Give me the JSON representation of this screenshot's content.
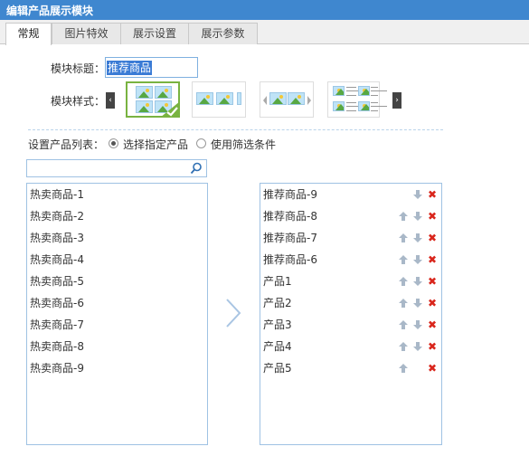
{
  "window": {
    "title": "编辑产品展示模块"
  },
  "tabs": [
    {
      "label": "常规",
      "active": true
    },
    {
      "label": "图片特效",
      "active": false
    },
    {
      "label": "展示设置",
      "active": false
    },
    {
      "label": "展示参数",
      "active": false
    }
  ],
  "module_title": {
    "label": "模块标题：",
    "value": "推荐商品"
  },
  "module_style": {
    "label": "模块样式：",
    "selected_index": 0
  },
  "product_list": {
    "label": "设置产品列表：",
    "options": [
      "选择指定产品",
      "使用筛选条件"
    ],
    "selected": "选择指定产品"
  },
  "search": {
    "value": "",
    "placeholder": ""
  },
  "source_items": [
    "热卖商品-1",
    "热卖商品-2",
    "热卖商品-3",
    "热卖商品-4",
    "热卖商品-5",
    "热卖商品-6",
    "热卖商品-7",
    "热卖商品-8",
    "热卖商品-9"
  ],
  "selected_items": [
    {
      "label": "推荐商品-9",
      "up": false,
      "down": true
    },
    {
      "label": "推荐商品-8",
      "up": true,
      "down": true
    },
    {
      "label": "推荐商品-7",
      "up": true,
      "down": true
    },
    {
      "label": "推荐商品-6",
      "up": true,
      "down": true
    },
    {
      "label": "产品1",
      "up": true,
      "down": true
    },
    {
      "label": "产品2",
      "up": true,
      "down": true
    },
    {
      "label": "产品3",
      "up": true,
      "down": true
    },
    {
      "label": "产品4",
      "up": true,
      "down": true
    },
    {
      "label": "产品5",
      "up": true,
      "down": false
    }
  ],
  "colors": {
    "titlebar": "#3f87cf",
    "accent_green": "#79b341",
    "remove_red": "#d9261c",
    "arrow_gray": "#a9b8c8"
  },
  "icons": {
    "move_right": "chevron-right-icon",
    "search": "search-icon",
    "up": "arrow-up-icon",
    "down": "arrow-down-icon",
    "remove": "close-icon"
  }
}
